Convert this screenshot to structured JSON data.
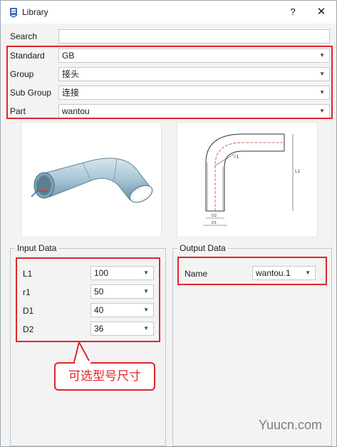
{
  "window": {
    "title": "Library",
    "icon": "library-app-icon",
    "help_label": "?",
    "close_label": "✕"
  },
  "form": {
    "search": {
      "label": "Search",
      "value": ""
    },
    "standard": {
      "label": "Standard",
      "value": "GB"
    },
    "group": {
      "label": "Group",
      "value": "接头"
    },
    "sub_group": {
      "label": "Sub Group",
      "value": "连接"
    },
    "part": {
      "label": "Part",
      "value": "wantou"
    }
  },
  "input_data": {
    "title": "Input Data",
    "params": [
      {
        "label": "L1",
        "value": "100"
      },
      {
        "label": "r1",
        "value": "50"
      },
      {
        "label": "D1",
        "value": "40"
      },
      {
        "label": "D2",
        "value": "36"
      }
    ]
  },
  "output_data": {
    "title": "Output Data",
    "name_label": "Name",
    "name_value": "wantou.1"
  },
  "annotation": {
    "callout_text": "可选型号尺寸",
    "color": "#e0262b"
  },
  "drawing_labels": {
    "length": "L1",
    "radius": "r1",
    "d1": "D1",
    "d2": "D2"
  },
  "watermark": "Yuucn.com",
  "colors": {
    "highlight": "#e0262b",
    "pipe": "#a9c6d6",
    "axis_x": "#d23b3b",
    "axis_y": "#2f9e4a",
    "axis_z": "#3560c8"
  }
}
